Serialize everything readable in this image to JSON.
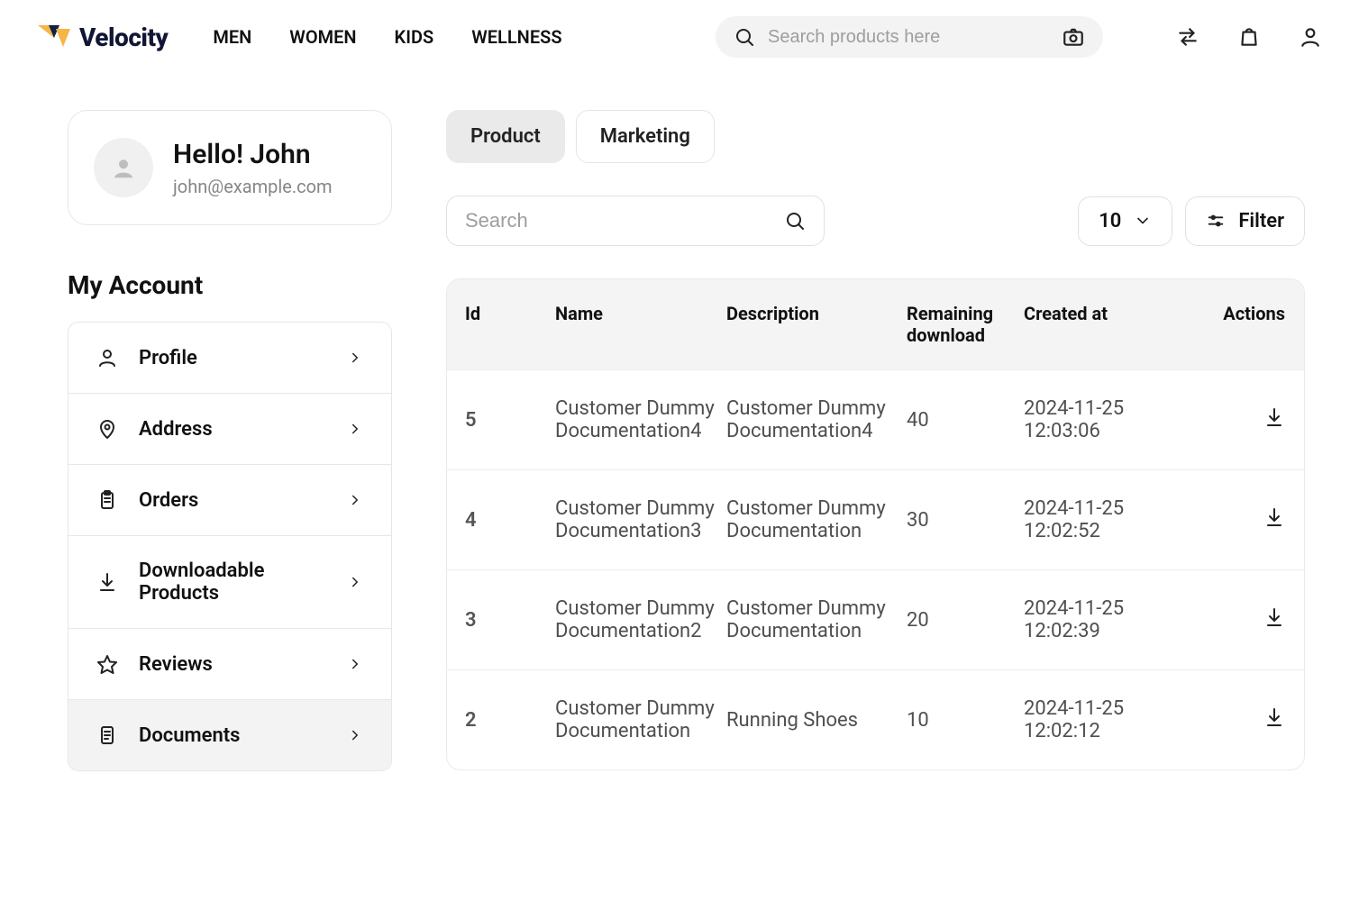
{
  "brand": {
    "name": "Velocity"
  },
  "nav": [
    {
      "label": "MEN"
    },
    {
      "label": "WOMEN"
    },
    {
      "label": "KIDS"
    },
    {
      "label": "WELLNESS"
    }
  ],
  "header_search": {
    "placeholder": "Search products here"
  },
  "user": {
    "greeting": "Hello! John",
    "email": "john@example.com"
  },
  "sidebar": {
    "title": "My Account",
    "items": [
      {
        "label": "Profile",
        "icon": "user"
      },
      {
        "label": "Address",
        "icon": "pin"
      },
      {
        "label": "Orders",
        "icon": "clipboard"
      },
      {
        "label": "Downloadable Products",
        "icon": "download"
      },
      {
        "label": "Reviews",
        "icon": "star"
      },
      {
        "label": "Documents",
        "icon": "document",
        "active": true
      }
    ]
  },
  "tabs": [
    {
      "label": "Product",
      "active": true
    },
    {
      "label": "Marketing"
    }
  ],
  "toolbar": {
    "search_placeholder": "Search",
    "per_page": "10",
    "filter_label": "Filter"
  },
  "table": {
    "columns": [
      "Id",
      "Name",
      "Description",
      "Remaining download",
      "Created at",
      "Actions"
    ],
    "rows": [
      {
        "id": "5",
        "name": "Customer Dummy Documentation4",
        "description": "Customer Dummy Documentation4",
        "remaining": "40",
        "created": "2024-11-25 12:03:06"
      },
      {
        "id": "4",
        "name": "Customer Dummy Documentation3",
        "description": "Customer Dummy Documentation",
        "remaining": "30",
        "created": "2024-11-25 12:02:52"
      },
      {
        "id": "3",
        "name": "Customer Dummy Documentation2",
        "description": "Customer Dummy Documentation",
        "remaining": "20",
        "created": "2024-11-25 12:02:39"
      },
      {
        "id": "2",
        "name": "Customer Dummy Documentation",
        "description": "Running Shoes",
        "remaining": "10",
        "created": "2024-11-25 12:02:12"
      }
    ]
  }
}
